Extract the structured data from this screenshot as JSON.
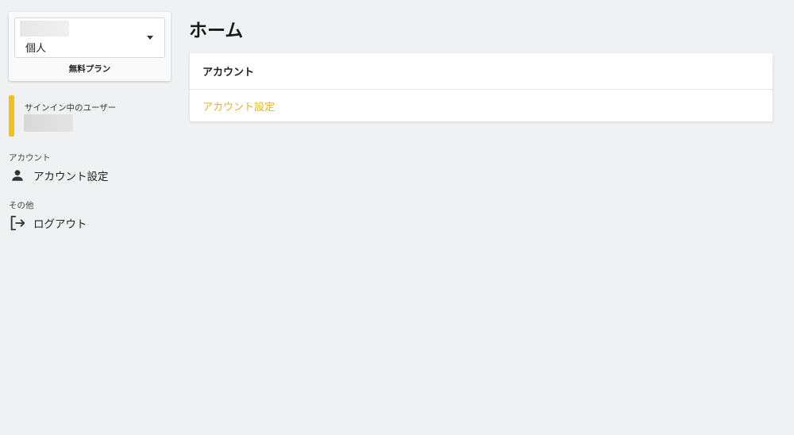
{
  "sidebar": {
    "account_type": "個人",
    "plan": "無料プラン",
    "signin_label": "サインイン中のユーザー",
    "sections": [
      {
        "title": "アカウント",
        "items": [
          {
            "label": "アカウント設定",
            "icon": "person-icon"
          }
        ]
      },
      {
        "title": "その他",
        "items": [
          {
            "label": "ログアウト",
            "icon": "logout-icon"
          }
        ]
      }
    ]
  },
  "main": {
    "title": "ホーム",
    "card": {
      "header": "アカウント",
      "link": "アカウント設定"
    }
  },
  "colors": {
    "accent": "#f2c01b",
    "link": "#e8b320",
    "background": "#eff1f2"
  }
}
